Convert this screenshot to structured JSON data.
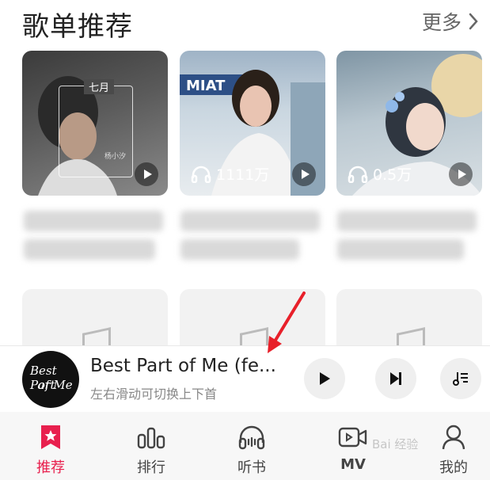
{
  "header": {
    "title": "歌单推荐",
    "more_label": "更多"
  },
  "playlists": [
    {
      "overlay_title": "七月",
      "overlay_sub": "杨小汐",
      "overlay_sub2": "",
      "play_count": ""
    },
    {
      "play_count": "1111万"
    },
    {
      "play_count": "0.5万"
    }
  ],
  "player": {
    "title": "Best Part of Me (fe...",
    "subtitle": "左右滑动可切换上下首",
    "disc_text_line1": "Best Part",
    "disc_text_line2": "of Me"
  },
  "tabs": [
    {
      "label": "推荐",
      "icon": "star-bookmark-icon",
      "active": true
    },
    {
      "label": "排行",
      "icon": "bar-chart-icon",
      "active": false
    },
    {
      "label": "听书",
      "icon": "headphones-icon",
      "active": false
    },
    {
      "label": "MV",
      "icon": "video-camera-icon",
      "active": false
    },
    {
      "label": "我的",
      "icon": "person-icon",
      "active": false
    }
  ],
  "colors": {
    "accent": "#e8204e",
    "annotation_arrow": "#e8202a"
  },
  "watermark": "Bai 经验"
}
